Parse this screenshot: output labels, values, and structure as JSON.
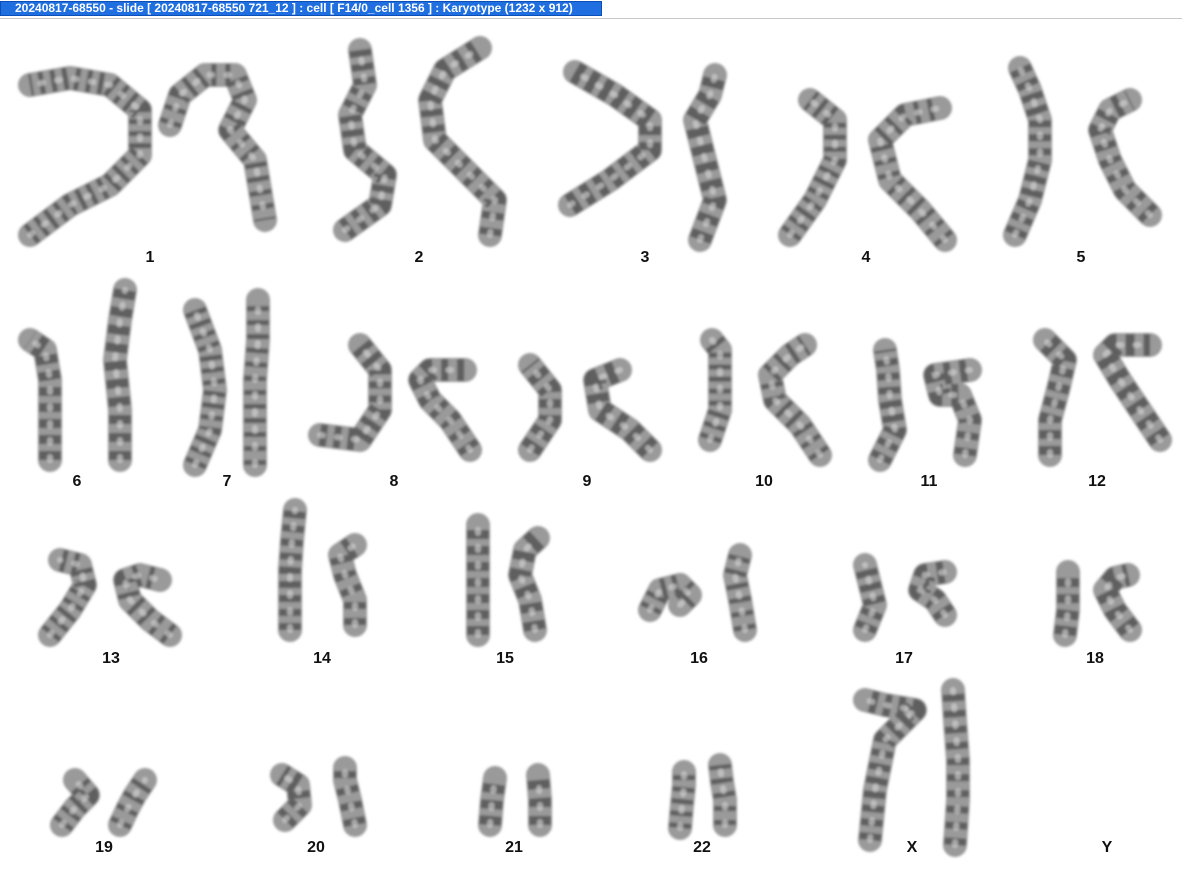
{
  "window": {
    "title": "20240817-68550 - slide [ 20240817-68550 721_12 ] : cell [ F14/0_cell 1356 ] : Karyotype  (1232 x 912)"
  },
  "karyotype": {
    "labels": [
      "1",
      "2",
      "3",
      "4",
      "5",
      "6",
      "7",
      "8",
      "9",
      "10",
      "11",
      "12",
      "13",
      "14",
      "15",
      "16",
      "17",
      "18",
      "19",
      "20",
      "21",
      "22",
      "X",
      "Y"
    ]
  },
  "colors": {
    "title_bar": "#1f6fe0",
    "chromosome": "#6b6b6b",
    "background": "#ffffff"
  }
}
